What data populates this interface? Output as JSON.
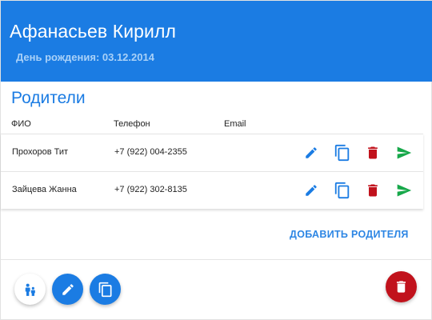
{
  "colors": {
    "primary": "#1b7ce3",
    "danger": "#c1121c",
    "success": "#17a84a",
    "birthday_text": "#a9d1f8"
  },
  "child": {
    "name": "Афанасьев Кирилл",
    "birthday": "День рождения: 03.12.2014"
  },
  "parents": {
    "title": "Родители",
    "columns": {
      "fio": "ФИО",
      "phone": "Телефон",
      "email": "Email"
    },
    "rows": [
      {
        "fio": "Прохоров Тит",
        "phone": "+7 (922) 004-2355",
        "email": ""
      },
      {
        "fio": "Зайцева Жанна",
        "phone": "+7 (922) 302-8135",
        "email": ""
      }
    ],
    "row_actions": [
      "pencil-icon",
      "copy-icon",
      "trash-icon",
      "send-icon"
    ],
    "add_button": "ДОБАВИТЬ РОДИТЕЛЯ"
  },
  "footer": {
    "fabs": [
      "family-icon",
      "pencil-icon",
      "copy-icon",
      "trash-icon"
    ]
  }
}
